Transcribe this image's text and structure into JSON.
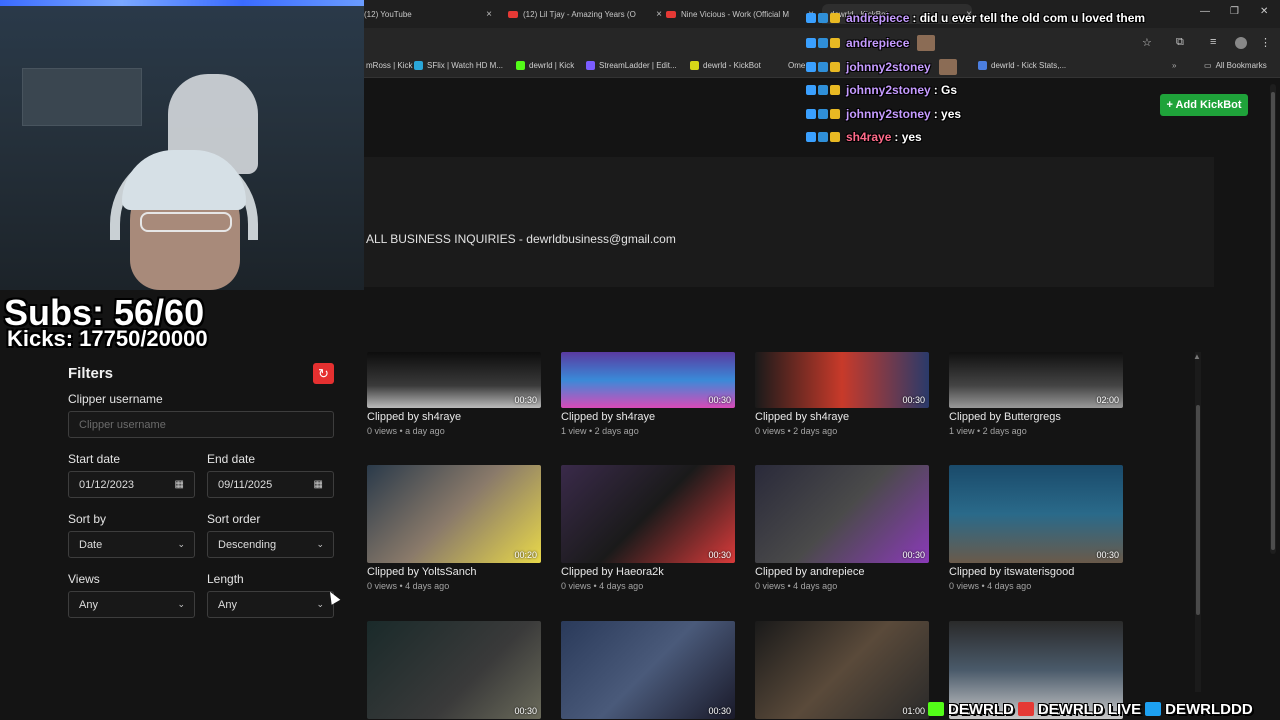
{
  "browser": {
    "tabs": [
      {
        "label": "(12) YouTube"
      },
      {
        "label": "(12) Lil Tjay - Amazing Years (O"
      },
      {
        "label": "Nine Vicious - Work (Official M"
      },
      {
        "label": "dewrld - KickBot"
      }
    ],
    "bookmarks": [
      {
        "label": "mRoss | Kick"
      },
      {
        "label": "SFlix | Watch HD M..."
      },
      {
        "label": "dewrld | Kick"
      },
      {
        "label": "StreamLadder | Edit..."
      },
      {
        "label": "dewrld - KickBot"
      },
      {
        "label": "Ome"
      },
      {
        "label": "dewrld - Kick Stats,..."
      },
      {
        "label": "All Bookmarks"
      }
    ],
    "colors": {
      "kick_green": "#53fc18",
      "youtube_red": "#e53935"
    }
  },
  "site": {
    "add_kickbot_label": "+ Add KickBot",
    "business_text": "ALL BUSINESS INQUIRIES - dewrldbusiness@gmail.com",
    "accent": "#1fa33a"
  },
  "filters": {
    "title": "Filters",
    "reset_icon": "refresh-icon",
    "clipper_label": "Clipper username",
    "clipper_placeholder": "Clipper username",
    "start_label": "Start date",
    "start_value": "01/12/2023",
    "end_label": "End date",
    "end_value": "09/11/2025",
    "sort_by_label": "Sort by",
    "sort_by_value": "Date",
    "sort_order_label": "Sort order",
    "sort_order_value": "Descending",
    "views_label": "Views",
    "views_value": "Any",
    "length_label": "Length",
    "length_value": "Any"
  },
  "clips": [
    {
      "duration": "00:30",
      "by": "Clipped by sh4raye",
      "meta": "0 views • a day ago"
    },
    {
      "duration": "00:30",
      "by": "Clipped by sh4raye",
      "meta": "1 view • 2 days ago"
    },
    {
      "duration": "00:30",
      "by": "Clipped by sh4raye",
      "meta": "0 views • 2 days ago"
    },
    {
      "duration": "02:00",
      "by": "Clipped by Buttergregs",
      "meta": "1 view • 2 days ago"
    },
    {
      "duration": "00:20",
      "by": "Clipped by YoltsSanch",
      "meta": "0 views • 4 days ago"
    },
    {
      "duration": "00:30",
      "by": "Clipped by Haeora2k",
      "meta": "0 views • 4 days ago"
    },
    {
      "duration": "00:30",
      "by": "Clipped by andrepiece",
      "meta": "0 views • 4 days ago"
    },
    {
      "duration": "00:30",
      "by": "Clipped by itswaterisgood",
      "meta": "0 views • 4 days ago"
    },
    {
      "duration": "00:30",
      "by": "",
      "meta": ""
    },
    {
      "duration": "00:30",
      "by": "",
      "meta": ""
    },
    {
      "duration": "01:00",
      "by": "",
      "meta": ""
    },
    {
      "duration": "",
      "by": "",
      "meta": ""
    }
  ],
  "overlay": {
    "subs": "Subs: 56/60",
    "kicks": "Kicks: 17750/20000",
    "chat": [
      {
        "user": "andrepiece",
        "msg": ": did u ever tell the old com u loved them"
      },
      {
        "user": "andrepiece",
        "msg": ""
      },
      {
        "user": "johnny2stoney",
        "msg": ""
      },
      {
        "user": "johnny2stoney",
        "msg": ": Gs"
      },
      {
        "user": "johnny2stoney",
        "msg": ": yes"
      },
      {
        "user": "sh4raye",
        "msg": ": yes"
      }
    ],
    "social": [
      "DEWRLD",
      "DEWRLD LIVE",
      "DEWRLDDD"
    ]
  }
}
